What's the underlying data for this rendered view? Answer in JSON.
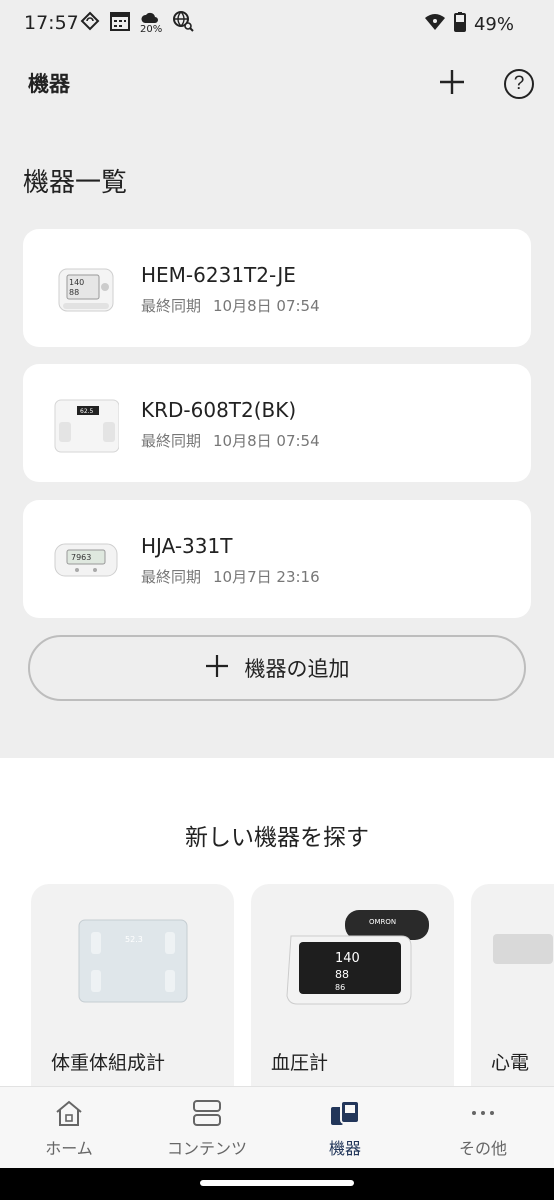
{
  "status_bar": {
    "time": "17:57",
    "weather_percent": "20%",
    "battery": "49%",
    "icons": [
      "sync-icon",
      "calendar-icon",
      "weather-icon",
      "globe-search-icon",
      "wifi-icon",
      "battery-icon"
    ]
  },
  "app_bar": {
    "title": "機器",
    "add_icon": "plus-icon",
    "help_label": "?"
  },
  "device_list": {
    "title": "機器一覧",
    "sync_label": "最終同期",
    "devices": [
      {
        "name": "HEM-6231T2-JE",
        "sync_label": "最終同期",
        "sync_time": "10月8日 07:54",
        "type": "wrist-bp-monitor"
      },
      {
        "name": "KRD-608T2(BK)",
        "sync_label": "最終同期",
        "sync_time": "10月8日 07:54",
        "type": "body-scale"
      },
      {
        "name": "HJA-331T",
        "sync_label": "最終同期",
        "sync_time": "10月7日 23:16",
        "type": "pedometer"
      }
    ],
    "add_button_label": "機器の追加"
  },
  "find_devices": {
    "title": "新しい機器を探す",
    "categories": [
      {
        "label": "体重体組成計",
        "image": "body-composition-scale"
      },
      {
        "label": "血圧計",
        "image": "blood-pressure-monitor"
      },
      {
        "label": "心電",
        "image": "ecg-device"
      }
    ]
  },
  "bottom_nav": {
    "items": [
      {
        "label": "ホーム",
        "icon": "home-icon",
        "active": false
      },
      {
        "label": "コンテンツ",
        "icon": "contents-icon",
        "active": false
      },
      {
        "label": "機器",
        "icon": "devices-icon",
        "active": true
      },
      {
        "label": "その他",
        "icon": "more-icon",
        "active": false
      }
    ]
  },
  "colors": {
    "background": "#eeeeee",
    "card": "#ffffff",
    "text_primary": "#222222",
    "text_secondary": "#777777",
    "active_nav": "#22365a"
  }
}
